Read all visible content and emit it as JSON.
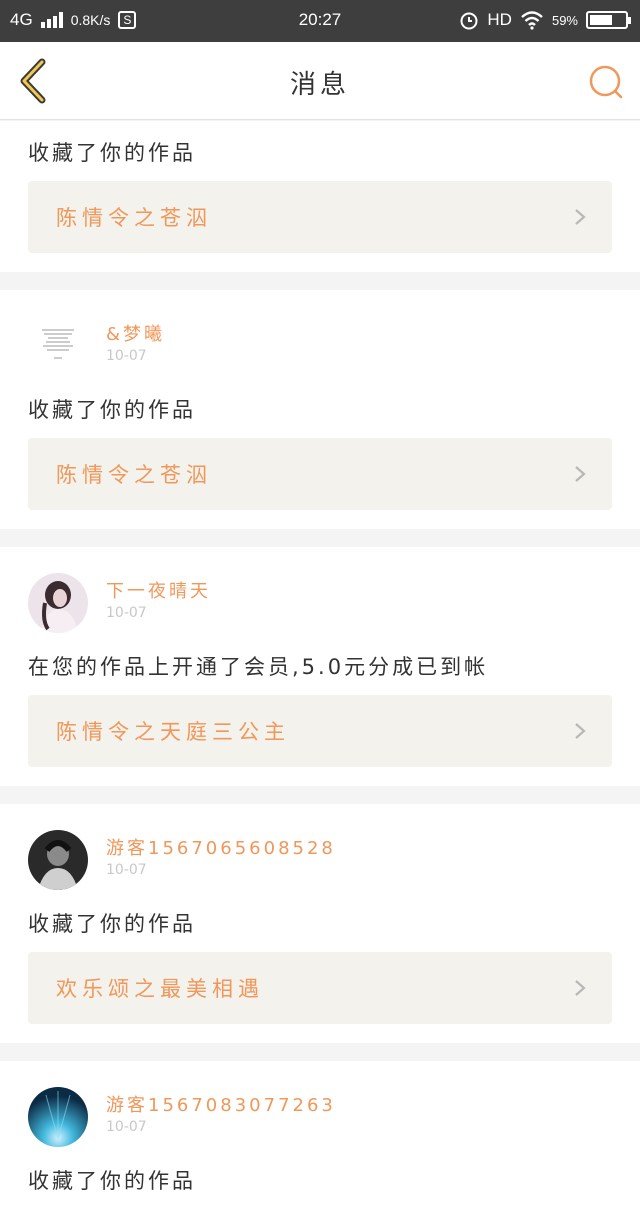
{
  "status_bar": {
    "network": "4G",
    "speed": "0.8K/s",
    "s_badge": "S",
    "time": "20:27",
    "hd": "HD",
    "battery": "59%"
  },
  "header": {
    "title": "消息"
  },
  "colors": {
    "accent": "#f0975a",
    "link_bg": "#f3f2ec",
    "status_bg": "#3e3e3e"
  },
  "notifications": [
    {
      "message": "收藏了你的作品",
      "work_title": "陈情令之苍泅"
    },
    {
      "username": "&梦曦",
      "date": "10-07",
      "message": "收藏了你的作品",
      "work_title": "陈情令之苍泅"
    },
    {
      "username": "下一夜晴天",
      "date": "10-07",
      "message": "在您的作品上开通了会员,5.0元分成已到帐",
      "work_title": "陈情令之天庭三公主"
    },
    {
      "username": "游客1567065608528",
      "date": "10-07",
      "message": "收藏了你的作品",
      "work_title": "欢乐颂之最美相遇"
    },
    {
      "username": "游客1567083077263",
      "date": "10-07",
      "message": "收藏了你的作品"
    }
  ]
}
